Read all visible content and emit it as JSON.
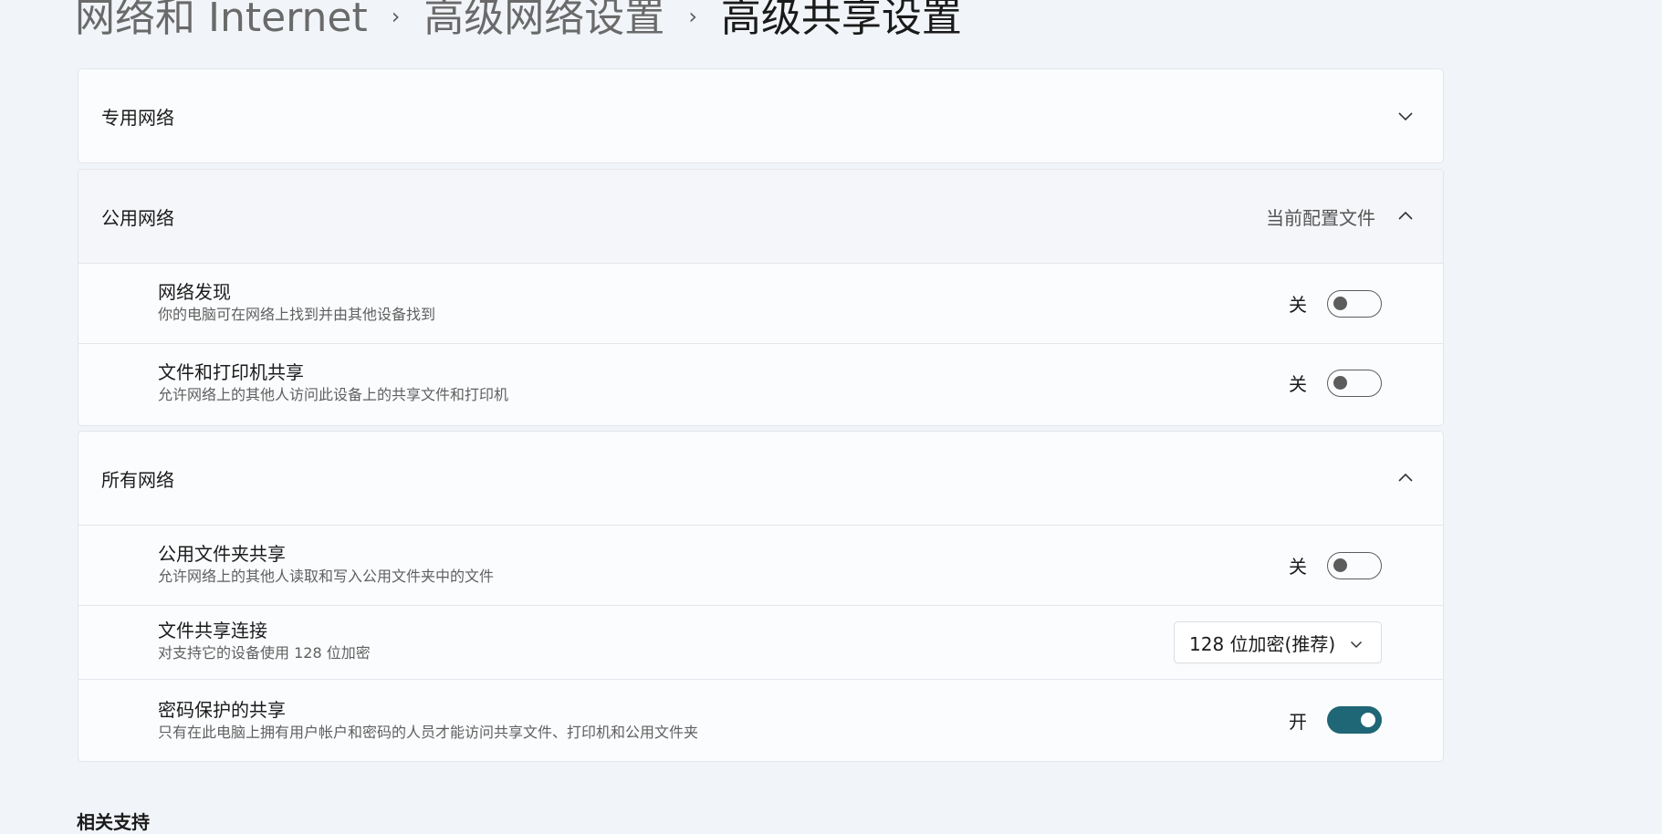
{
  "breadcrumb": {
    "level1": "网络和 Internet",
    "level2": "高级网络设置",
    "current": "高级共享设置"
  },
  "private_network": {
    "title": "专用网络"
  },
  "public_network": {
    "title": "公用网络",
    "profile_tag": "当前配置文件",
    "settings": [
      {
        "title": "网络发现",
        "desc": "你的电脑可在网络上找到并由其他设备找到",
        "state": "关",
        "enabled": false
      },
      {
        "title": "文件和打印机共享",
        "desc": "允许网络上的其他人访问此设备上的共享文件和打印机",
        "state": "关",
        "enabled": false
      }
    ]
  },
  "all_networks": {
    "title": "所有网络",
    "public_folder": {
      "title": "公用文件夹共享",
      "desc": "允许网络上的其他人读取和写入公用文件夹中的文件",
      "state": "关",
      "enabled": false
    },
    "file_sharing": {
      "title": "文件共享连接",
      "desc": "对支持它的设备使用 128 位加密",
      "selected": "128 位加密(推荐)"
    },
    "password_sharing": {
      "title": "密码保护的共享",
      "desc": "只有在此电脑上拥有用户帐户和密码的人员才能访问共享文件、打印机和公用文件夹",
      "state": "开",
      "enabled": true
    }
  },
  "related": {
    "title": "相关支持"
  },
  "colors": {
    "accent": "#1f6676",
    "background": "#f1f4f8",
    "card": "#fbfcfe"
  }
}
